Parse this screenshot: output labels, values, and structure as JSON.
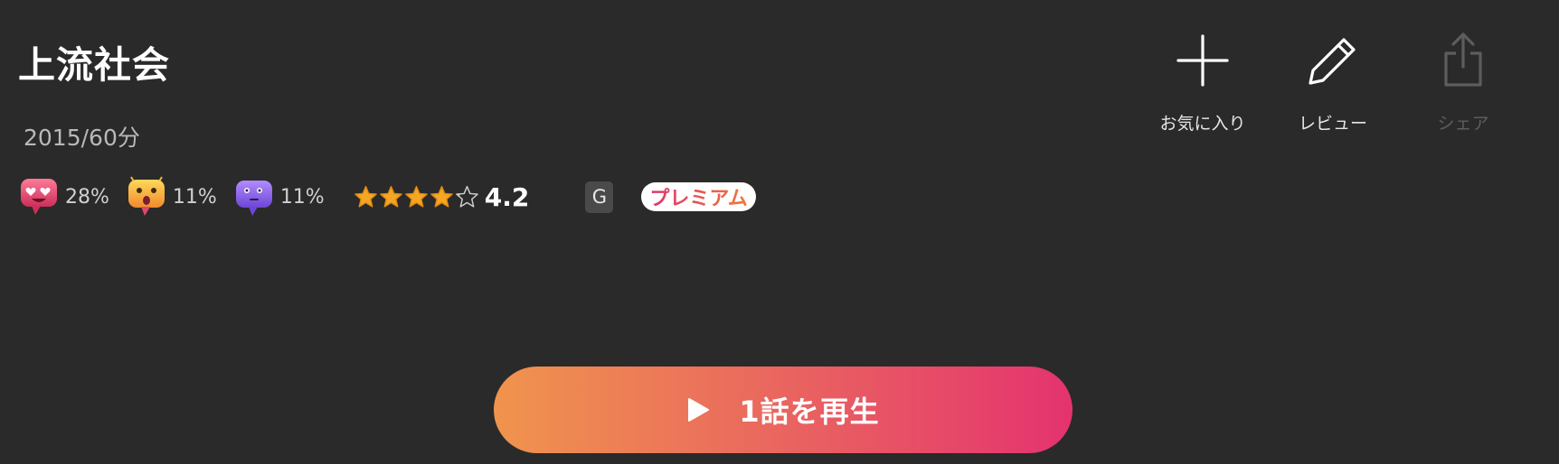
{
  "show": {
    "title": "上流社会",
    "meta": "2015/60分"
  },
  "reactions": [
    {
      "icon": "heart-eyes-emoji-icon",
      "percent": "28%",
      "color": "#e0476c"
    },
    {
      "icon": "surprised-emoji-icon",
      "percent": "11%",
      "color": "#f5b53a"
    },
    {
      "icon": "neutral-emoji-icon",
      "percent": "11%",
      "color": "#8f63e8"
    }
  ],
  "rating": {
    "stars_value": 4.2,
    "stars_max": 5,
    "score_label": "4.2"
  },
  "badges": {
    "grade": "G",
    "premium": "プレミアム"
  },
  "actions": [
    {
      "icon": "plus-icon",
      "label": "お気に入り",
      "enabled": true
    },
    {
      "icon": "pencil-icon",
      "label": "レビュー",
      "enabled": true
    },
    {
      "icon": "share-icon",
      "label": "シェア",
      "enabled": false
    }
  ],
  "play_button": {
    "icon": "play-icon",
    "label": "1話を再生"
  },
  "colors": {
    "background": "#2a2a2a",
    "star": "#f5a623",
    "gradient_start": "#f0944d",
    "gradient_end": "#e4336f"
  }
}
